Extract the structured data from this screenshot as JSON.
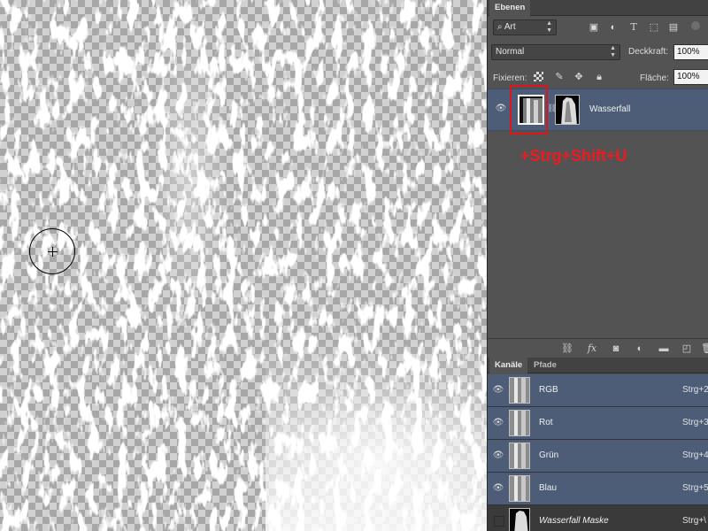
{
  "canvas": {
    "cursor": "brush-cursor"
  },
  "layers_panel": {
    "tab": "Ebenen",
    "filter": {
      "value": "Art"
    },
    "blend_mode": {
      "value": "Normal"
    },
    "opacity": {
      "label": "Deckkraft:",
      "value": "100%"
    },
    "lock": {
      "label": "Fixieren:"
    },
    "fill": {
      "label": "Fläche:",
      "value": "100%"
    },
    "layer": {
      "name": "Wasserfall"
    },
    "icons": [
      "image-filter-icon",
      "adjustment-filter-icon",
      "type-filter-icon",
      "shape-filter-icon",
      "smart-object-filter-icon",
      "lock-transparency-icon",
      "lock-brush-icon",
      "lock-move-icon",
      "lock-all-icon",
      "link-icon",
      "fx-icon",
      "mask-icon",
      "adjustment-icon",
      "folder-icon",
      "new-layer-icon",
      "trash-icon"
    ]
  },
  "annotation": {
    "shortcut": "+Strg+Shift+U",
    "highlight_color": "#e0141b"
  },
  "channels_panel": {
    "tabs": [
      "Kanäle",
      "Pfade"
    ],
    "channels": [
      {
        "name": "RGB",
        "shortcut": "Strg+2"
      },
      {
        "name": "Rot",
        "shortcut": "Strg+3"
      },
      {
        "name": "Grün",
        "shortcut": "Strg+4"
      },
      {
        "name": "Blau",
        "shortcut": "Strg+5"
      },
      {
        "name": "Wasserfall Maske",
        "shortcut": "Strg+\\"
      }
    ]
  },
  "colors": {
    "selected_row": "#4d5d78",
    "panel_bg": "#535353"
  }
}
